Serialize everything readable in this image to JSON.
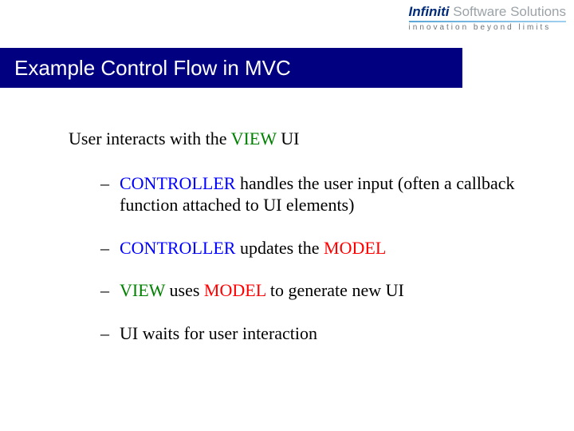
{
  "logo": {
    "brand": "Infiniti",
    "rest": " Software Solutions",
    "tagline": "innovation beyond limits"
  },
  "title": "Example Control Flow in MVC",
  "lead": {
    "prefix": "User interacts with the ",
    "view_word": "VIEW",
    "suffix": " UI"
  },
  "bullets": {
    "b1": {
      "controller": "CONTROLLER",
      "rest": " handles the user input (often a callback function attached to UI elements)"
    },
    "b2": {
      "controller": "CONTROLLER",
      "mid": " updates the ",
      "model": "MODEL"
    },
    "b3": {
      "view": "VIEW",
      "mid1": " uses ",
      "model": "MODEL",
      "mid2": " to generate new UI"
    },
    "b4": {
      "text": "UI waits for user interaction"
    }
  }
}
